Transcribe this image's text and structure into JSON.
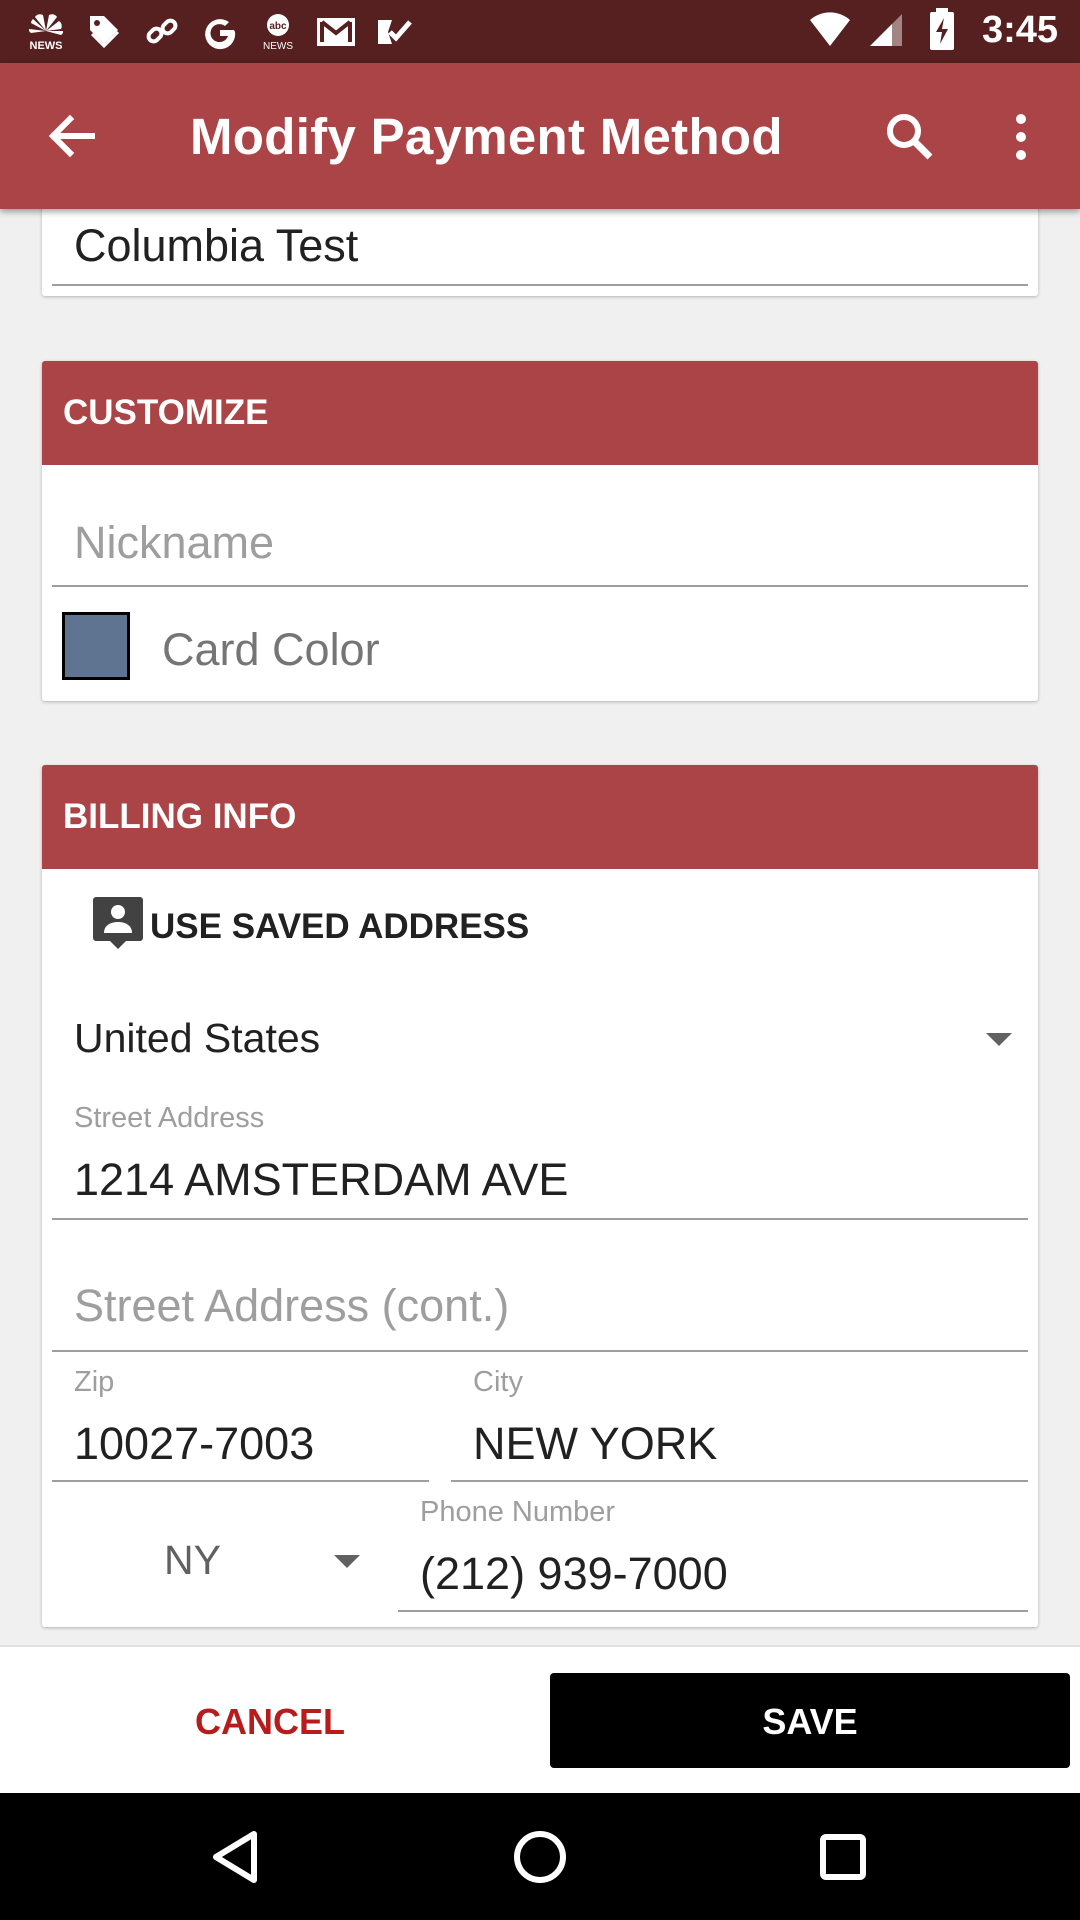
{
  "status_bar": {
    "time": "3:45",
    "left_icons": [
      "nbc-news-icon",
      "tag-icon",
      "link-icon",
      "google-icon",
      "abc-news-icon",
      "gmail-icon",
      "tasks-icon"
    ],
    "right_icons": [
      "wifi-icon",
      "cell-signal-icon",
      "battery-charging-icon"
    ]
  },
  "app_bar": {
    "title": "Modify Payment Method"
  },
  "name_field": {
    "value": "Columbia Test"
  },
  "customize": {
    "header": "CUSTOMIZE",
    "nickname_placeholder": "Nickname",
    "card_color_label": "Card Color",
    "card_color": "#5f7490"
  },
  "billing": {
    "header": "BILLING INFO",
    "use_saved_address": "USE SAVED ADDRESS",
    "country": "United States",
    "street_label": "Street Address",
    "street_value": "1214 AMSTERDAM AVE",
    "street2_placeholder": "Street Address (cont.)",
    "zip_label": "Zip",
    "zip_value": "10027-7003",
    "city_label": "City",
    "city_value": "NEW YORK",
    "state_value": "NY",
    "phone_label": "Phone Number",
    "phone_value": "(212) 939-7000"
  },
  "actions": {
    "cancel": "CANCEL",
    "save": "SAVE"
  },
  "colors": {
    "primary": "#ab4446",
    "status_bar": "#561f20",
    "cancel_text": "#b71c1c"
  }
}
